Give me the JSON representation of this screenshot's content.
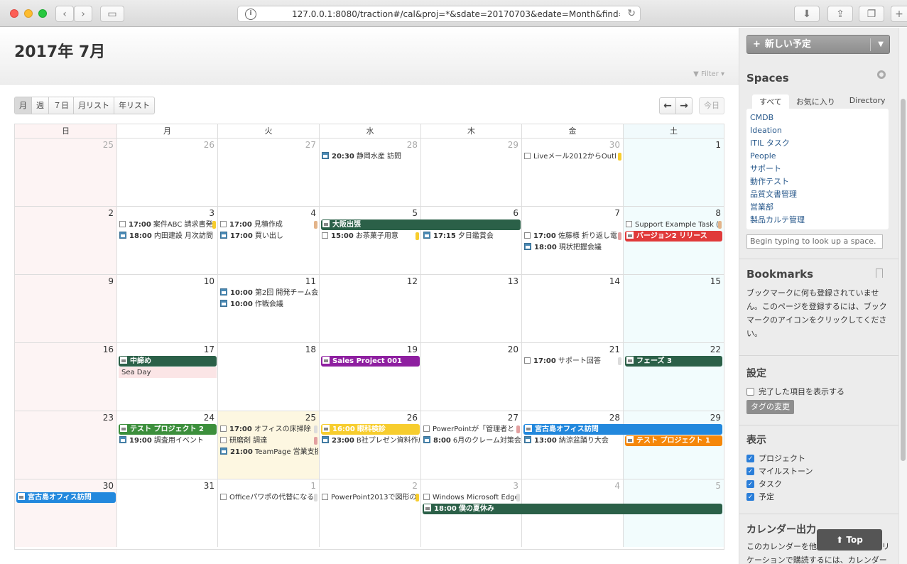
{
  "browser": {
    "url": "127.0.0.1:8080/traction#/cal&proj=*&sdate=20170703&edate=Month&find=(f%20",
    "back_icon": "chevron-left-icon",
    "forward_icon": "chevron-right-icon"
  },
  "header": {
    "title": "2017年 7月",
    "filter_label": "Filter"
  },
  "view_tabs": [
    "月",
    "週",
    "７日",
    "月リスト",
    "年リスト"
  ],
  "nav": {
    "prev": "←",
    "next": "→",
    "today": "今日"
  },
  "weekdays": [
    "日",
    "月",
    "火",
    "水",
    "木",
    "金",
    "土"
  ],
  "weeks": [
    [
      "25",
      "26",
      "27",
      "28",
      "29",
      "30",
      "1"
    ],
    [
      "2",
      "3",
      "4",
      "5",
      "6",
      "7",
      "8"
    ],
    [
      "9",
      "10",
      "11",
      "12",
      "13",
      "14",
      "15"
    ],
    [
      "16",
      "17",
      "18",
      "19",
      "20",
      "21",
      "22"
    ],
    [
      "23",
      "24",
      "25",
      "26",
      "27",
      "28",
      "29"
    ],
    [
      "30",
      "31",
      "1",
      "2",
      "3",
      "4",
      "5"
    ]
  ],
  "events": {
    "w0_wed_1": {
      "time": "20:30",
      "text": "静岡水産 訪問"
    },
    "w0_fri_1": {
      "time": "",
      "text": "Liveメール2012からOutl"
    },
    "w1_mon_1": {
      "time": "17:00",
      "text": "案件ABC 請求書発"
    },
    "w1_mon_2": {
      "time": "18:00",
      "text": "内田建設 月次訪問"
    },
    "w1_tue_1": {
      "time": "17:00",
      "text": "見積作成"
    },
    "w1_tue_2": {
      "time": "17:00",
      "text": "買い出し"
    },
    "w1_wed_bar": {
      "time": "",
      "text": "大阪出張"
    },
    "w1_wed_2": {
      "time": "15:00",
      "text": "お茶菓子用意"
    },
    "w1_thu_2": {
      "time": "17:15",
      "text": "夕日鑑賞会"
    },
    "w1_fri_2": {
      "time": "17:00",
      "text": "佐藤様 折り返し電"
    },
    "w1_fri_3": {
      "time": "18:00",
      "text": "現状把握会議"
    },
    "w1_sat_1": {
      "time": "",
      "text": "Support Example Task ("
    },
    "w1_sat_2": {
      "time": "",
      "text": "バージョン2 リリース"
    },
    "w2_tue_1": {
      "time": "10:00",
      "text": "第2回 開発チーム会"
    },
    "w2_tue_2": {
      "time": "10:00",
      "text": "作戦会議"
    },
    "w3_mon_bar": {
      "time": "",
      "text": "中締め"
    },
    "w3_mon_2": {
      "time": "",
      "text": "Sea Day"
    },
    "w3_wed_bar": {
      "time": "",
      "text": "Sales Project 001"
    },
    "w3_fri_1": {
      "time": "17:00",
      "text": "サポート回答"
    },
    "w3_sat_bar": {
      "time": "",
      "text": "フェーズ 3"
    },
    "w4_mon_bar": {
      "time": "",
      "text": "テスト プロジェクト 2"
    },
    "w4_mon_2": {
      "time": "19:00",
      "text": "調査用イベント"
    },
    "w4_tue_1": {
      "time": "17:00",
      "text": "オフィスの床掃除"
    },
    "w4_tue_2": {
      "time": "",
      "text": "研磨剤 調達"
    },
    "w4_tue_3": {
      "time": "21:00",
      "text": "TeamPage 営業支援"
    },
    "w4_wed_1": {
      "time": "16:00",
      "text": "眼科検診"
    },
    "w4_wed_2": {
      "time": "23:00",
      "text": "B社プレゼン資料作成"
    },
    "w4_thu_1": {
      "time": "",
      "text": "PowerPointが「管理者と"
    },
    "w4_thu_2": {
      "time": "8:00",
      "text": "6月のクレーム対策会"
    },
    "w4_fri_bar": {
      "time": "",
      "text": "宮古島オフィス訪問"
    },
    "w4_fri_2": {
      "time": "13:00",
      "text": "納涼盆踊り大会"
    },
    "w4_sat_bar": {
      "time": "",
      "text": "テスト プロジェクト 1"
    },
    "w5_sun_bar": {
      "time": "",
      "text": "宮古島オフィス訪問"
    },
    "w5_tue_1": {
      "time": "",
      "text": "Officeパワポの代替になる"
    },
    "w5_wed_1": {
      "time": "",
      "text": "PowerPoint2013で図形の"
    },
    "w5_thu_1": {
      "time": "",
      "text": "Windows Microsoft Edge"
    },
    "w5_thu_bar": {
      "time": "18:00",
      "text": "僕の夏休み"
    }
  },
  "colors": {
    "green": "#2b6048",
    "red": "#e03a3a",
    "purple": "#8e1fa0",
    "blue": "#2288dd",
    "orange": "#f5870a",
    "yellow": "#f7cd2e",
    "green2": "#3c8f3c"
  },
  "sidebar": {
    "new_button": "新しい予定",
    "spaces_title": "Spaces",
    "space_tabs": [
      "すべて",
      "お気に入り",
      "Directory"
    ],
    "spaces": [
      "CMDB",
      "Ideation",
      "ITIL タスク",
      "People",
      "サポート",
      "動作テスト",
      "品質文書管理",
      "営業部",
      "製品カルテ管理"
    ],
    "space_search_placeholder": "Begin typing to look up a space.",
    "bookmarks_title": "Bookmarks",
    "bookmarks_text": "ブックマークに何も登録されていません。このページを登録するには、ブックマークのアイコンをクリックしてください。",
    "settings_title": "設定",
    "show_done_label": "完了した項目を表示する",
    "tag_button": "タグの変更",
    "display_title": "表示",
    "display_options": [
      "プロジェクト",
      "マイルストーン",
      "タスク",
      "予定"
    ],
    "export_title": "カレンダー出力",
    "export_text": "このカレンダーを他のカレンダー アプリケーションで購読するには、カレンダー",
    "top_button": "Top"
  }
}
